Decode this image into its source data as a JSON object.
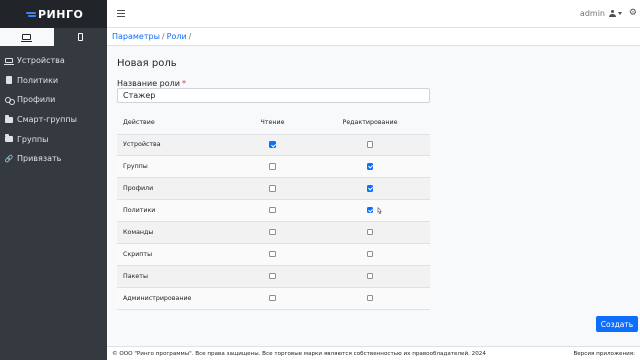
{
  "brand": {
    "name": "РИНГО"
  },
  "sidebar": {
    "items": [
      {
        "label": "Устройства",
        "icon": "laptop-icon"
      },
      {
        "label": "Политики",
        "icon": "book-icon"
      },
      {
        "label": "Профили",
        "icon": "users-icon"
      },
      {
        "label": "Смарт-группы",
        "icon": "folder-icon"
      },
      {
        "label": "Группы",
        "icon": "folder-icon"
      },
      {
        "label": "Привязать",
        "icon": "link-icon"
      }
    ]
  },
  "header": {
    "user": "admin"
  },
  "breadcrumb": {
    "items": [
      "Параметры",
      "Роли"
    ]
  },
  "page": {
    "title": "Новая роль",
    "role_label": "Название роли",
    "required_mark": "*",
    "role_value": "Стажер"
  },
  "table": {
    "headers": {
      "action": "Действие",
      "read": "Чтение",
      "edit": "Редактирование"
    },
    "rows": [
      {
        "label": "Устройства",
        "read": true,
        "edit": false
      },
      {
        "label": "Группы",
        "read": false,
        "edit": true
      },
      {
        "label": "Профили",
        "read": false,
        "edit": true
      },
      {
        "label": "Политики",
        "read": false,
        "edit": true
      },
      {
        "label": "Команды",
        "read": false,
        "edit": false
      },
      {
        "label": "Скрипты",
        "read": false,
        "edit": false
      },
      {
        "label": "Пакеты",
        "read": false,
        "edit": false
      },
      {
        "label": "Администрирование",
        "read": false,
        "edit": false
      }
    ]
  },
  "actions": {
    "create": "Создать"
  },
  "footer": {
    "copyright": "© ООО \"Ринго программы\". Все права защищены. Все торговые марки являются собственностью их правообладателей. 2024",
    "version": "Версия приложения: "
  },
  "colors": {
    "primary": "#0d6efd",
    "sidebar": "#343a40",
    "brand_bg": "#212529"
  }
}
